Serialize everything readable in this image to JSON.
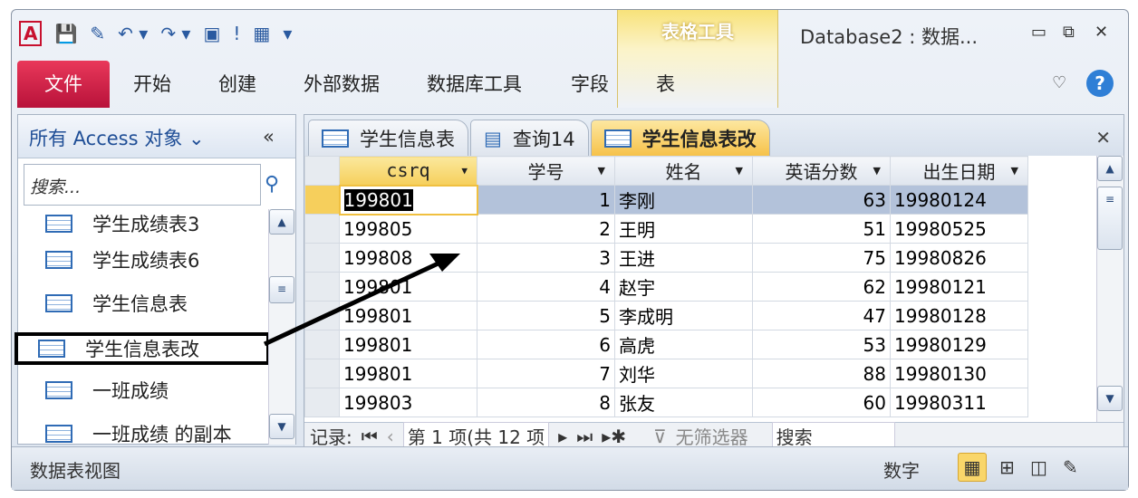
{
  "window": {
    "title": "Database2 : 数据...",
    "context_tab_group": "表格工具"
  },
  "ribbon": {
    "tabs": [
      "文件",
      "开始",
      "创建",
      "外部数据",
      "数据库工具",
      "字段",
      "表"
    ]
  },
  "nav": {
    "header": "所有 Access 对象",
    "search_placeholder": "搜索...",
    "items": [
      "学生成绩表3",
      "学生成绩表6",
      "学生信息表",
      "学生信息表改",
      "一班成绩",
      "一班成绩 的副本"
    ]
  },
  "doc_tabs": [
    "学生信息表",
    "查询14",
    "学生信息表改"
  ],
  "table": {
    "columns": [
      "csrq",
      "学号",
      "姓名",
      "英语分数",
      "出生日期"
    ],
    "rows": [
      [
        "199801",
        "1",
        "李刚",
        "63",
        "19980124"
      ],
      [
        "199805",
        "2",
        "王明",
        "51",
        "19980525"
      ],
      [
        "199808",
        "3",
        "王进",
        "75",
        "19980826"
      ],
      [
        "199801",
        "4",
        "赵宇",
        "62",
        "19980121"
      ],
      [
        "199801",
        "5",
        "李成明",
        "47",
        "19980128"
      ],
      [
        "199801",
        "6",
        "高虎",
        "53",
        "19980129"
      ],
      [
        "199801",
        "7",
        "刘华",
        "88",
        "19980130"
      ],
      [
        "199803",
        "8",
        "张友",
        "60",
        "19980311"
      ]
    ]
  },
  "record_nav": {
    "label": "记录:",
    "position": "第 1 项(共 12 项",
    "filter": "无筛选器",
    "search": "搜索"
  },
  "status": {
    "view": "数据表视图",
    "mode": "数字"
  }
}
